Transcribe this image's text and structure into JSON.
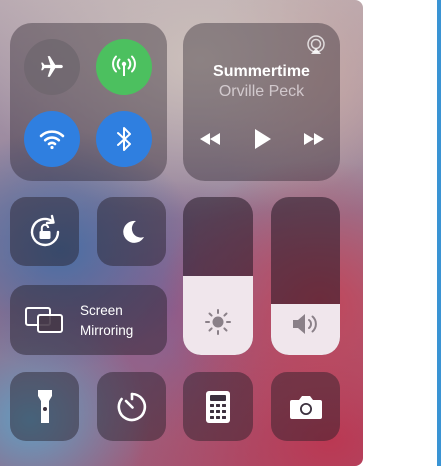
{
  "connectivity": {
    "airplane": {
      "label": "Airplane Mode",
      "state": "off"
    },
    "cellular": {
      "label": "Cellular Data",
      "state": "on"
    },
    "wifi": {
      "label": "Wi-Fi",
      "state": "on"
    },
    "bluetooth": {
      "label": "Bluetooth",
      "state": "on"
    }
  },
  "now_playing": {
    "title": "Summertime",
    "artist": "Orville Peck"
  },
  "controls": {
    "screen_mirroring_line1": "Screen",
    "screen_mirroring_line2": "Mirroring"
  },
  "sliders": {
    "brightness_level": 0.5,
    "volume_level": 0.32
  },
  "icons": [
    "airplane-icon",
    "cellular-antenna-icon",
    "wifi-icon",
    "bluetooth-icon",
    "airplay-icon",
    "rewind-icon",
    "play-icon",
    "fast-forward-icon",
    "rotation-lock-icon",
    "moon-icon",
    "screen-mirroring-icon",
    "sun-icon",
    "speaker-icon",
    "flashlight-icon",
    "timer-icon",
    "calculator-icon",
    "camera-icon"
  ],
  "colors": {
    "cellular_on": "#4cc05f",
    "wifi_on": "#2f7fe0",
    "bluetooth_on": "#2f7fe0",
    "slider_fill": "#f0e6ec"
  }
}
